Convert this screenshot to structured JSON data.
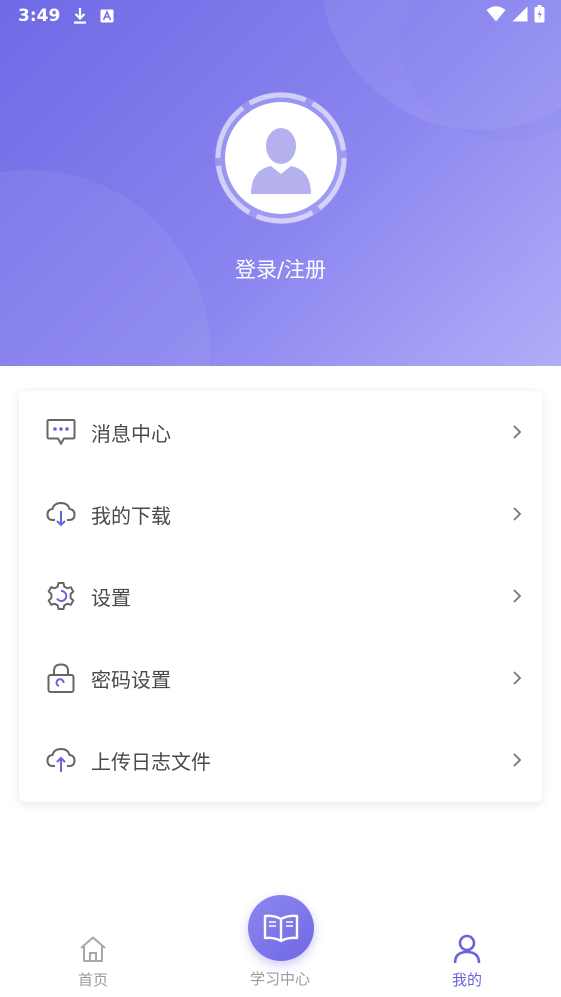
{
  "status_bar": {
    "time": "3:49",
    "left_icons": [
      "download-icon",
      "notification-a-icon"
    ],
    "right_icons": [
      "wifi-icon",
      "signal-icon",
      "battery-icon"
    ]
  },
  "header": {
    "login_label": "登录/注册",
    "gradient_colors": [
      "#7069e6",
      "#b1adf7"
    ]
  },
  "menu": {
    "items": [
      {
        "label": "消息中心",
        "icon": "message-icon"
      },
      {
        "label": "我的下载",
        "icon": "cloud-download-icon"
      },
      {
        "label": "设置",
        "icon": "gear-icon"
      },
      {
        "label": "密码设置",
        "icon": "lock-icon"
      },
      {
        "label": "上传日志文件",
        "icon": "cloud-upload-icon"
      }
    ]
  },
  "tabbar": {
    "home_label": "首页",
    "study_label": "学习中心",
    "mine_label": "我的",
    "active": "我的",
    "accent_color": "#6a63de"
  }
}
